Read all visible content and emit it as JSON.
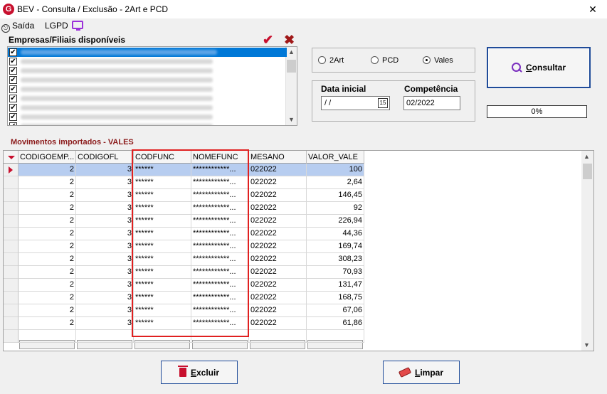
{
  "window": {
    "title": "BEV - Consulta / Exclusão - 2Art e PCD",
    "app_icon": "G"
  },
  "menu": {
    "exit": "Saída",
    "lgpd": "LGPD"
  },
  "companies": {
    "label": "Empresas/Filiais disponíveis",
    "row_count": 9,
    "selected_index": 0
  },
  "radio": {
    "options": [
      "2Art",
      "PCD",
      "Vales"
    ],
    "selected": "Vales"
  },
  "dates": {
    "initial_label": "Data inicial",
    "initial_value": " /  /",
    "calendar_icon": "15",
    "competence_label": "Competência",
    "competence_value": "02/2022"
  },
  "buttons": {
    "consultar": "Consultar",
    "excluir": "Excluir",
    "limpar": "Limpar"
  },
  "progress": {
    "text": "0%",
    "value": 0
  },
  "movements": {
    "label": "Movimentos importados  - VALES",
    "columns": [
      "CODIGOEMP...",
      "CODIGOFL",
      "CODFUNC",
      "NOMEFUNC",
      "MESANO",
      "VALOR_VALE"
    ],
    "rows": [
      [
        "2",
        "3",
        "******",
        "************...",
        "022022",
        "100"
      ],
      [
        "2",
        "3",
        "******",
        "************...",
        "022022",
        "2,64"
      ],
      [
        "2",
        "3",
        "******",
        "************...",
        "022022",
        "146,45"
      ],
      [
        "2",
        "3",
        "******",
        "************...",
        "022022",
        "92"
      ],
      [
        "2",
        "3",
        "******",
        "************...",
        "022022",
        "226,94"
      ],
      [
        "2",
        "3",
        "******",
        "************...",
        "022022",
        "44,36"
      ],
      [
        "2",
        "3",
        "******",
        "************...",
        "022022",
        "169,74"
      ],
      [
        "2",
        "3",
        "******",
        "************...",
        "022022",
        "308,23"
      ],
      [
        "2",
        "3",
        "******",
        "************...",
        "022022",
        "70,93"
      ],
      [
        "2",
        "3",
        "******",
        "************...",
        "022022",
        "131,47"
      ],
      [
        "2",
        "3",
        "******",
        "************...",
        "022022",
        "168,75"
      ],
      [
        "2",
        "3",
        "******",
        "************...",
        "022022",
        "67,06"
      ],
      [
        "2",
        "3",
        "******",
        "************...",
        "022022",
        "61,86"
      ]
    ],
    "selected_row": 0
  },
  "colors": {
    "accent": "#c8102e",
    "selection": "#0078d7",
    "highlight_box": "#e02020"
  }
}
